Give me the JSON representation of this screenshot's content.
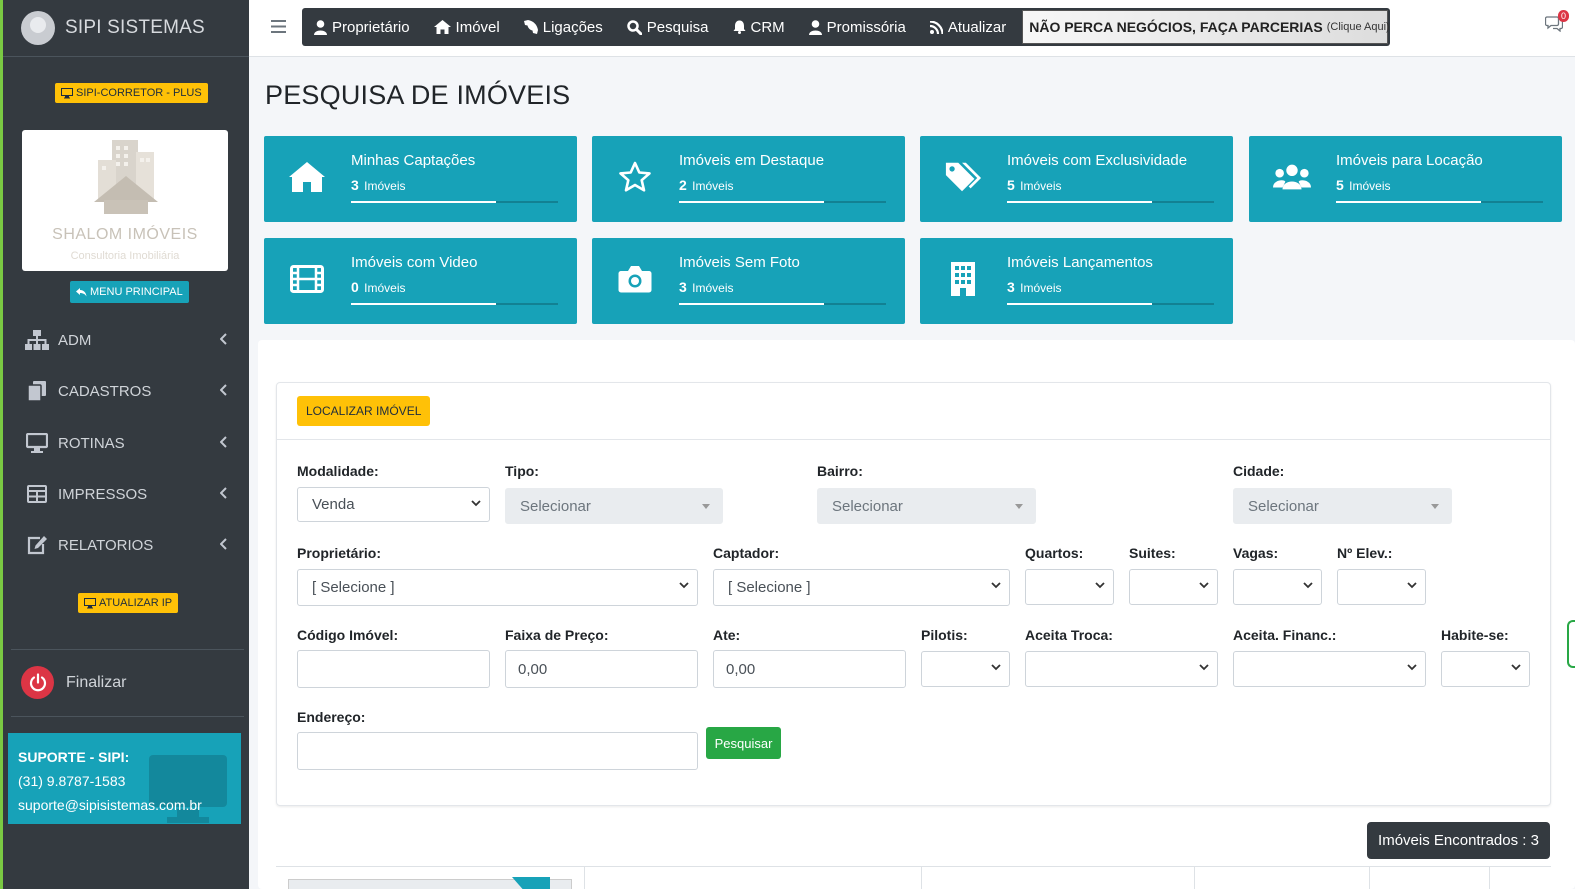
{
  "sidebar": {
    "brand": "SIPI SISTEMAS",
    "plan_badge": "SIPI-CORRETOR - PLUS",
    "logo_name": "SHALOM IMÓVEIS",
    "logo_sub": "Consultoria Imobiliária",
    "menu_principal": "MENU PRINCIPAL",
    "items": [
      {
        "label": "ADM",
        "icon": "sitemap-icon"
      },
      {
        "label": "CADASTROS",
        "icon": "copy-icon"
      },
      {
        "label": "ROTINAS",
        "icon": "desktop-icon"
      },
      {
        "label": "IMPRESSOS",
        "icon": "table-icon"
      },
      {
        "label": "RELATORIOS",
        "icon": "edit-icon"
      }
    ],
    "atualizar_ip": "ATUALIZAR IP",
    "finalizar": "Finalizar",
    "support": {
      "title": "SUPORTE - SIPI:",
      "phone": "(31) 9.8787-1583",
      "email": "suporte@sipisistemas.com.br"
    }
  },
  "topnav": {
    "items": [
      {
        "label": "Proprietário",
        "icon": "user-icon"
      },
      {
        "label": "Imóvel",
        "icon": "home-icon"
      },
      {
        "label": "Ligações",
        "icon": "phone-icon"
      },
      {
        "label": "Pesquisa",
        "icon": "search-icon"
      },
      {
        "label": "CRM",
        "icon": "bell-icon"
      },
      {
        "label": "Promissória",
        "icon": "user-icon"
      },
      {
        "label": "Atualizar",
        "icon": "rss-icon"
      }
    ],
    "banner_text": "NÃO PERCA NEGÓCIOS, FAÇA PARCERIAS",
    "banner_link": "(Clique Aqui)",
    "messages_count": "0"
  },
  "page_title": "PESQUISA DE IMÓVEIS",
  "cards": [
    {
      "title": "Minhas Captações",
      "count": "3",
      "unit": "Imóveis",
      "icon": "home-icon",
      "progress": 0.7
    },
    {
      "title": "Imóveis em Destaque",
      "count": "2",
      "unit": "Imóveis",
      "icon": "star-icon",
      "progress": 0.7
    },
    {
      "title": "Imóveis com Exclusividade",
      "count": "5",
      "unit": "Imóveis",
      "icon": "tags-icon",
      "progress": 0.7
    },
    {
      "title": "Imóveis para Locação",
      "count": "5",
      "unit": "Imóveis",
      "icon": "users-icon",
      "progress": 0.7
    },
    {
      "title": "Imóveis com Video",
      "count": "0",
      "unit": "Imóveis",
      "icon": "film-icon",
      "progress": 0.7
    },
    {
      "title": "Imóveis Sem Foto",
      "count": "3",
      "unit": "Imóveis",
      "icon": "camera-icon",
      "progress": 0.7
    },
    {
      "title": "Imóveis Lançamentos",
      "count": "3",
      "unit": "Imóveis",
      "icon": "building-icon",
      "progress": 0.7
    }
  ],
  "form": {
    "header_button": "LOCALIZAR IMÓVEL",
    "modalidade": {
      "label": "Modalidade:",
      "value": "Venda"
    },
    "tipo": {
      "label": "Tipo:",
      "value": "Selecionar"
    },
    "bairro": {
      "label": "Bairro:",
      "value": "Selecionar"
    },
    "cidade": {
      "label": "Cidade:",
      "value": "Selecionar"
    },
    "proprietario": {
      "label": "Proprietário:",
      "value": "[ Selecione ]"
    },
    "captador": {
      "label": "Captador:",
      "value": "[ Selecione ]"
    },
    "quartos": {
      "label": "Quartos:",
      "value": ""
    },
    "suites": {
      "label": "Suites:",
      "value": ""
    },
    "vagas": {
      "label": "Vagas:",
      "value": ""
    },
    "elev": {
      "label": "Nº Elev.:",
      "value": ""
    },
    "codigo": {
      "label": "Código Imóvel:",
      "value": ""
    },
    "faixa": {
      "label": "Faixa de Preço:",
      "value": "0,00"
    },
    "ate": {
      "label": "Ate:",
      "value": "0,00"
    },
    "pilotis": {
      "label": "Pilotis:",
      "value": ""
    },
    "troca": {
      "label": "Aceita Troca:",
      "value": ""
    },
    "financ": {
      "label": "Aceita. Financ.:",
      "value": ""
    },
    "habite": {
      "label": "Habite-se:",
      "value": ""
    },
    "endereco": {
      "label": "Endereço:",
      "value": ""
    },
    "search_button": "Pesquisar"
  },
  "found_label": "Imóveis Encontrados : 3",
  "colors": {
    "sidebar": "#343a40",
    "card": "#17a2b8",
    "accent_yellow": "#ffc107",
    "success": "#28a745"
  }
}
